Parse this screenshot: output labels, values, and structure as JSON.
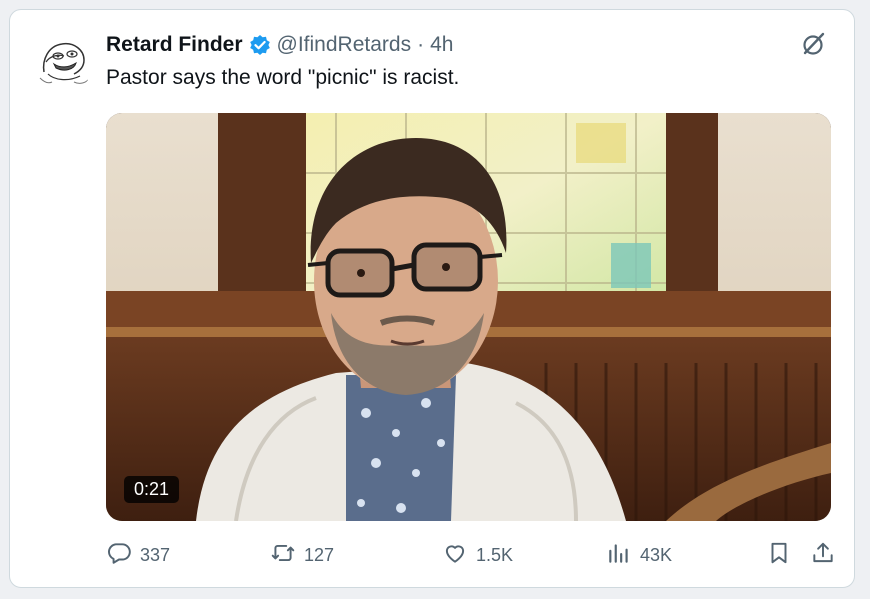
{
  "tweet": {
    "display_name": "Retard Finder",
    "handle": "@IfindRetards",
    "separator": "·",
    "time": "4h",
    "text": "Pastor says the word \"picnic\" is racist.",
    "verified": true
  },
  "media": {
    "type": "video",
    "duration": "0:21"
  },
  "actions": {
    "replies": "337",
    "reposts": "127",
    "likes": "1.5K",
    "views": "43K"
  },
  "colors": {
    "verified_badge": "#1d9bf0",
    "secondary_text": "#536471",
    "primary_text": "#0f1419"
  },
  "icons": [
    "verified-badge-icon",
    "grok-icon",
    "reply-icon",
    "repost-icon",
    "like-icon",
    "views-icon",
    "bookmark-icon",
    "share-icon"
  ]
}
